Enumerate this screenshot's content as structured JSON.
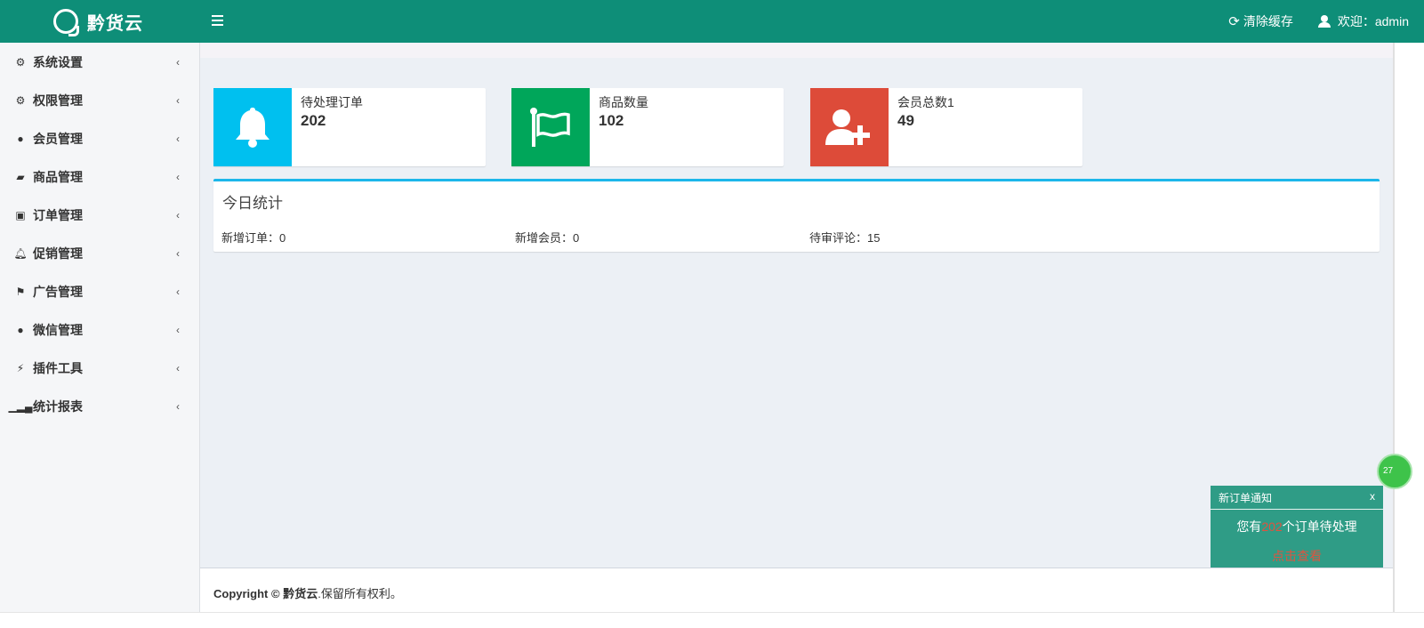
{
  "header": {
    "brand": "黔货云",
    "clear_cache": "清除缓存",
    "welcome": "欢迎：admin"
  },
  "sidebar": {
    "items": [
      {
        "label": "系统设置",
        "icon": "gear-icon"
      },
      {
        "label": "权限管理",
        "icon": "gears-icon"
      },
      {
        "label": "会员管理",
        "icon": "user-icon"
      },
      {
        "label": "商品管理",
        "icon": "book-icon"
      },
      {
        "label": "订单管理",
        "icon": "money-icon"
      },
      {
        "label": "促销管理",
        "icon": "bell-icon"
      },
      {
        "label": "广告管理",
        "icon": "flag-icon"
      },
      {
        "label": "微信管理",
        "icon": "wechat-icon"
      },
      {
        "label": "插件工具",
        "icon": "plug-icon"
      },
      {
        "label": "统计报表",
        "icon": "signal-icon"
      }
    ]
  },
  "info_boxes": [
    {
      "label": "待处理订单",
      "value": "202",
      "icon": "bell-icon",
      "color": "#00c0ef"
    },
    {
      "label": "商品数量",
      "value": "102",
      "icon": "flag-icon",
      "color": "#00a65a"
    },
    {
      "label": "会员总数1",
      "value": "49",
      "icon": "user-plus-icon",
      "color": "#dd4b39"
    }
  ],
  "today": {
    "title": "今日统计",
    "new_orders": "新增订单：0",
    "new_members": "新增会员：0",
    "pending_reviews": "待审评论：15"
  },
  "footer": {
    "copyright": "Copyright ©",
    "brand": "黔货云",
    "rights": ".保留所有权利。"
  },
  "notice": {
    "title": "新订单通知",
    "close": "x",
    "prefix": "您有",
    "count": "202",
    "suffix": "个订单待处理",
    "link": "点击查看"
  },
  "float_badge": "27",
  "colors": {
    "topbar": "#0e8e78",
    "accent_blue": "#1cb7ea",
    "notice_bg": "#2f9c86",
    "danger": "#e0533f"
  }
}
